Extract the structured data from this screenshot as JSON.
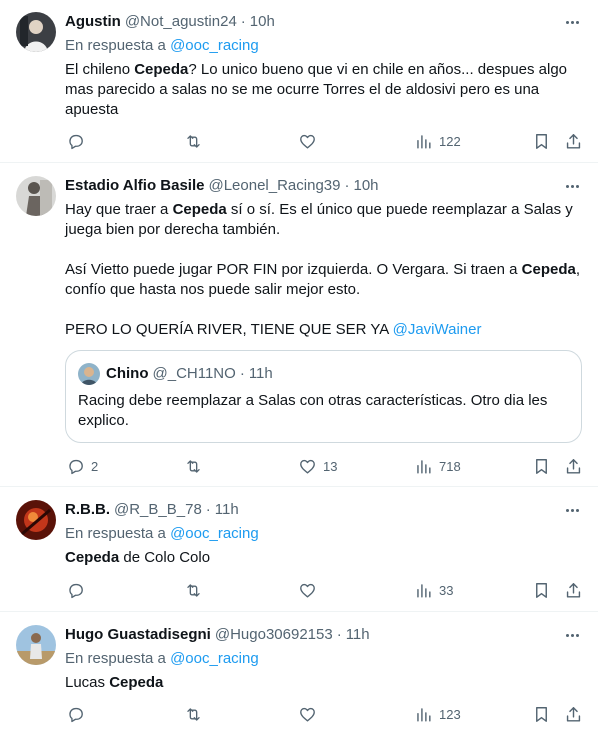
{
  "reply_label": "En respuesta a",
  "tweets": [
    {
      "name": "Agustin",
      "handle": "@Not_agustin24",
      "time": "10h",
      "reply_to": "@ooc_racing",
      "body": [
        {
          "t": "El chileno "
        },
        {
          "t": "Cepeda",
          "b": true
        },
        {
          "t": "? Lo unico bueno que vi en chile en años... despues algo mas parecido a salas no se me ocurre Torres el de aldosivi pero es una apuesta"
        }
      ],
      "stats": {
        "replies": "",
        "retweets": "",
        "likes": "",
        "views": "122"
      }
    },
    {
      "name": "Estadio Alfio Basile",
      "handle": "@Leonel_Racing39",
      "time": "10h",
      "paragraphs": [
        [
          {
            "t": "Hay que traer a "
          },
          {
            "t": "Cepeda",
            "b": true
          },
          {
            "t": " sí o sí. Es el único que puede reemplazar a Salas y juega bien por derecha también."
          }
        ],
        [
          {
            "t": "Así Vietto puede jugar POR FIN por izquierda. O Vergara. Si traen a "
          },
          {
            "t": "Cepeda",
            "b": true
          },
          {
            "t": ", confío que hasta nos puede salir mejor esto."
          }
        ],
        [
          {
            "t": "PERO LO QUERÍA RIVER, TIENE QUE SER YA "
          },
          {
            "t": "@JaviWainer",
            "link": true
          }
        ]
      ],
      "quote": {
        "name": "Chino",
        "handle": "@_CH11NO",
        "time": "11h",
        "body": "Racing debe reemplazar a Salas con otras características. Otro dia les explico."
      },
      "stats": {
        "replies": "2",
        "retweets": "",
        "likes": "13",
        "views": "718"
      }
    },
    {
      "name": "R.B.B.",
      "handle": "@R_B_B_78",
      "time": "11h",
      "reply_to": "@ooc_racing",
      "body": [
        {
          "t": "Cepeda",
          "b": true
        },
        {
          "t": " de Colo Colo"
        }
      ],
      "stats": {
        "replies": "",
        "retweets": "",
        "likes": "",
        "views": "33"
      }
    },
    {
      "name": "Hugo Guastadisegni",
      "handle": "@Hugo30692153",
      "time": "11h",
      "reply_to": "@ooc_racing",
      "body": [
        {
          "t": "Lucas "
        },
        {
          "t": "Cepeda",
          "b": true
        }
      ],
      "stats": {
        "replies": "",
        "retweets": "",
        "likes": "",
        "views": "123"
      }
    }
  ],
  "icons": {
    "reply": "comment-icon",
    "retweet": "retweet-icon",
    "like": "heart-icon",
    "views": "views-chart-icon",
    "bookmark": "bookmark-icon",
    "share": "share-icon",
    "more": "more-dots-icon"
  },
  "colors": {
    "text": "#0f1419",
    "secondary": "#536471",
    "link": "#1d9bf0",
    "divider": "#eff3f4",
    "quote_border": "#cfd9de"
  }
}
